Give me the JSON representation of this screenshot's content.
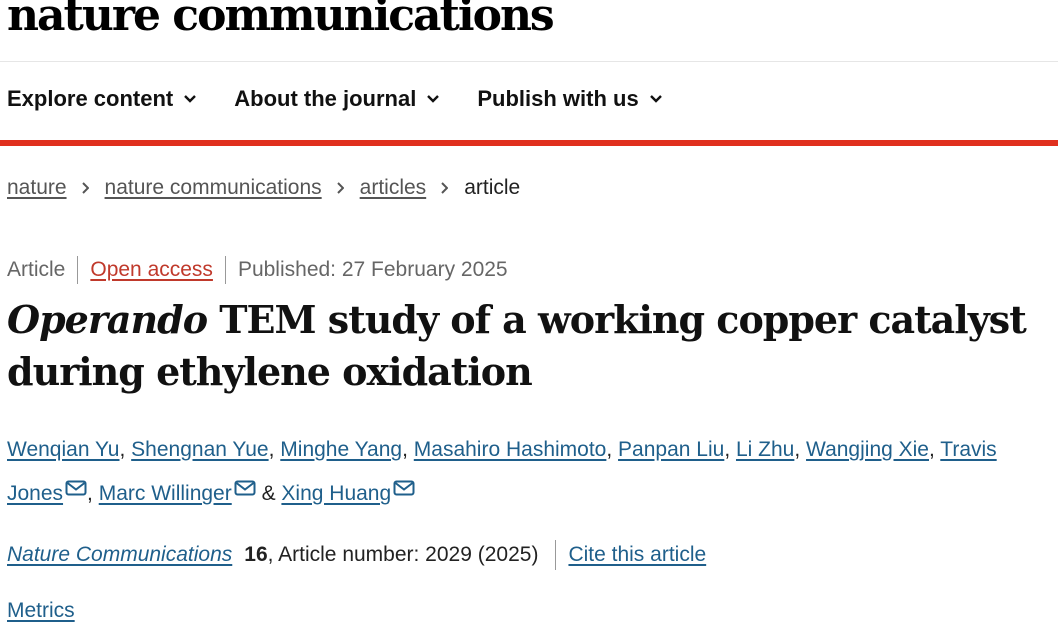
{
  "site": {
    "brand": "nature communications"
  },
  "nav": {
    "items": [
      {
        "label": "Explore content",
        "icon": "chevron-down-icon"
      },
      {
        "label": "About the journal",
        "icon": "chevron-down-icon"
      },
      {
        "label": "Publish with us",
        "icon": "chevron-down-icon"
      }
    ]
  },
  "breadcrumb": {
    "items": [
      "nature",
      "nature communications",
      "articles"
    ],
    "current": "article"
  },
  "article": {
    "type": "Article",
    "access": "Open access",
    "published": "Published: 27 February 2025",
    "title_italic": "Operando",
    "title_rest": " TEM study of a working copper catalyst during ethylene oxidation",
    "authors": [
      "Wenqian Yu",
      "Shengnan Yue",
      "Minghe Yang",
      "Masahiro Hashimoto",
      "Panpan Liu",
      "Li Zhu",
      "Wangjing Xie",
      "Travis Jones",
      "Marc Willinger",
      "Xing Huang"
    ],
    "author_sep": ", ",
    "author_and": " & ",
    "journal": "Nature Communications",
    "volume": "16",
    "article_number": ", Article number: 2029 (2025)",
    "cite_label": "Cite this article",
    "metrics_label": "Metrics"
  },
  "colors": {
    "accent_red": "#e0301e",
    "link_blue": "#1f5f8b",
    "open_access": "#c0392b"
  }
}
